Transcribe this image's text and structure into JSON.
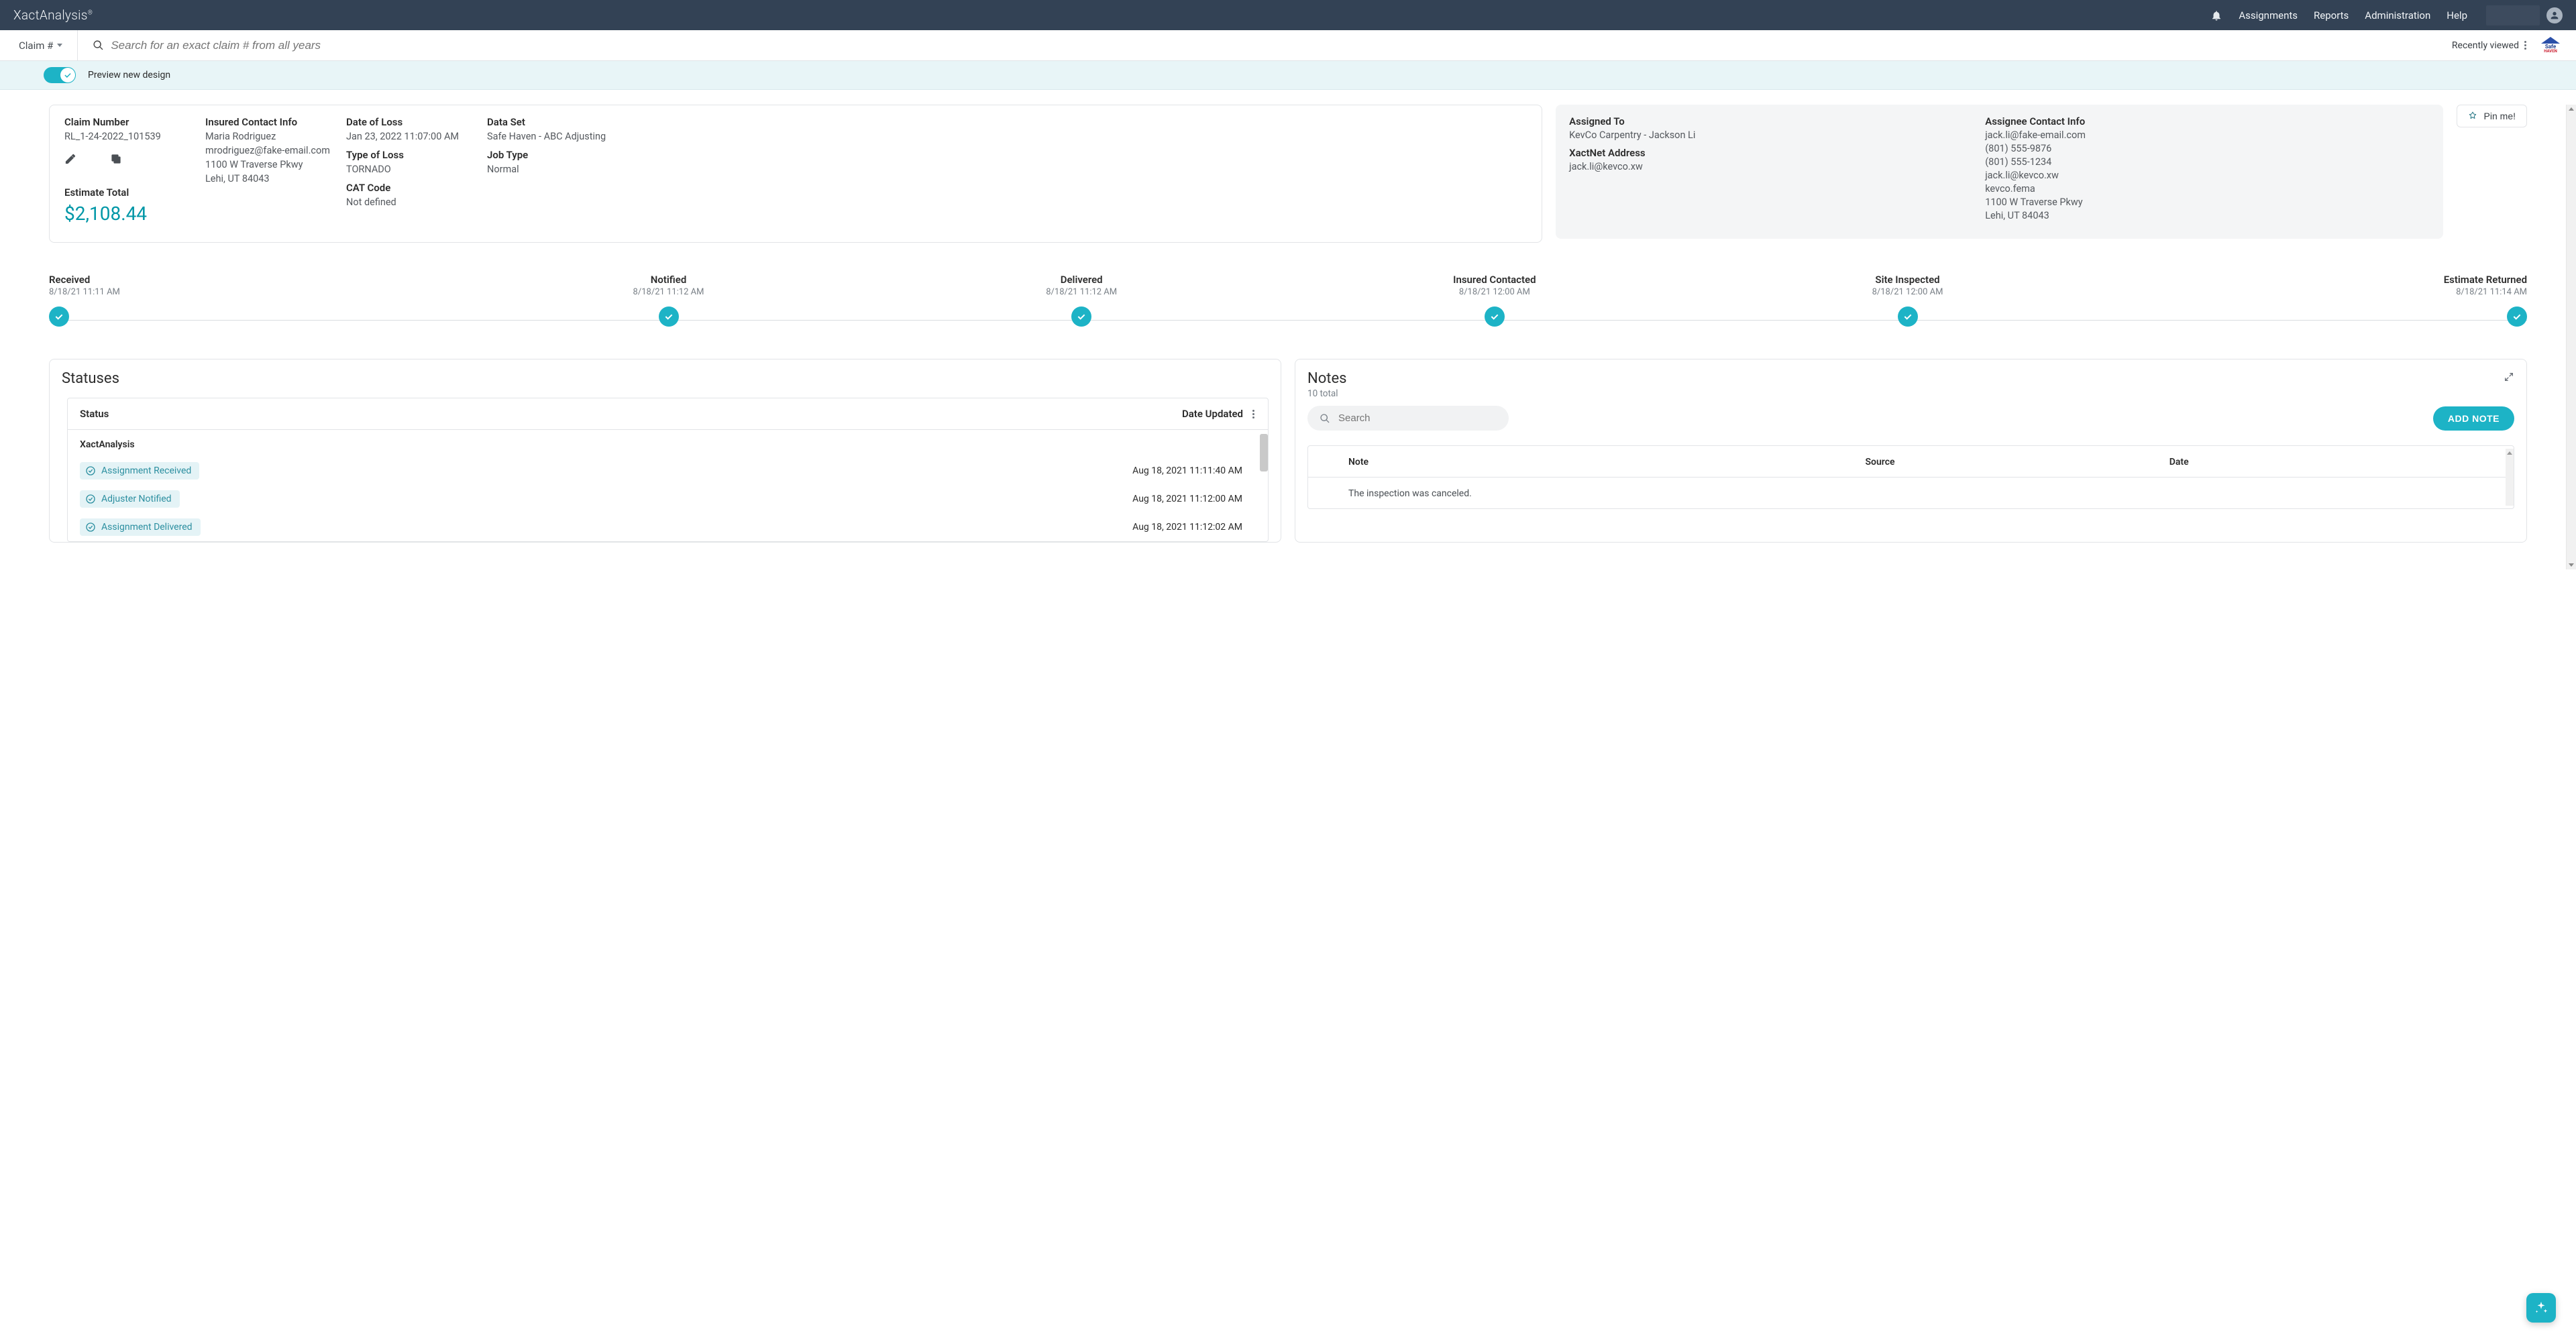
{
  "nav": {
    "brand": "XactAnalysis",
    "items": [
      "Assignments",
      "Reports",
      "Administration",
      "Help"
    ]
  },
  "searchbar": {
    "claim_selector": "Claim #",
    "search_placeholder": "Search for an exact claim # from all years",
    "recently_viewed": "Recently viewed",
    "logo_line1": "Safe",
    "logo_line2": "HAVEN"
  },
  "preview": {
    "label": "Preview new design"
  },
  "summary": {
    "claim_number_lbl": "Claim Number",
    "claim_number": "RL_1-24-2022_101539",
    "estimate_total_lbl": "Estimate Total",
    "estimate_total": "$2,108.44",
    "insured_lbl": "Insured Contact Info",
    "insured_name": "Maria Rodriguez",
    "insured_email": "mrodriguez@fake-email.com",
    "insured_addr1": "1100 W Traverse Pkwy",
    "insured_addr2": "Lehi, UT 84043",
    "dol_lbl": "Date of Loss",
    "dol": "Jan 23, 2022 11:07:00 AM",
    "tol_lbl": "Type of Loss",
    "tol": "TORNADO",
    "cat_lbl": "CAT Code",
    "cat": "Not defined",
    "ds_lbl": "Data Set",
    "ds": "Safe Haven - ABC Adjusting",
    "jt_lbl": "Job Type",
    "jt": "Normal"
  },
  "assignee": {
    "assigned_lbl": "Assigned To",
    "assigned_val": "KevCo Carpentry - Jackson Li",
    "xnet_lbl": "XactNet Address",
    "xnet_val": "jack.li@kevco.xw",
    "contact_lbl": "Assignee Contact Info",
    "email": "jack.li@fake-email.com",
    "phone1": "(801) 555-9876",
    "phone2": "(801) 555-1234",
    "email2": "jack.li@kevco.xw",
    "fema": "kevco.fema",
    "addr1": "1100 W Traverse Pkwy",
    "addr2": "Lehi, UT 84043"
  },
  "pin": {
    "label": "Pin me!"
  },
  "timeline": [
    {
      "label": "Received",
      "date": "8/18/21 11:11 AM"
    },
    {
      "label": "Notified",
      "date": "8/18/21 11:12 AM"
    },
    {
      "label": "Delivered",
      "date": "8/18/21 11:12 AM"
    },
    {
      "label": "Insured Contacted",
      "date": "8/18/21 12:00 AM"
    },
    {
      "label": "Site Inspected",
      "date": "8/18/21 12:00 AM"
    },
    {
      "label": "Estimate Returned",
      "date": "8/18/21 11:14 AM"
    }
  ],
  "statuses": {
    "title": "Statuses",
    "col_status": "Status",
    "col_date": "Date Updated",
    "group": "XactAnalysis",
    "rows": [
      {
        "name": "Assignment Received",
        "date": "Aug 18, 2021 11:11:40 AM"
      },
      {
        "name": "Adjuster Notified",
        "date": "Aug 18, 2021 11:12:00 AM"
      },
      {
        "name": "Assignment Delivered",
        "date": "Aug 18, 2021 11:12:02 AM"
      }
    ]
  },
  "notes": {
    "title": "Notes",
    "subtitle": "10 total",
    "search_placeholder": "Search",
    "add_btn": "ADD NOTE",
    "col_note": "Note",
    "col_source": "Source",
    "col_date": "Date",
    "rows": [
      {
        "note": "The inspection was canceled.",
        "source": "",
        "date": ""
      }
    ]
  }
}
